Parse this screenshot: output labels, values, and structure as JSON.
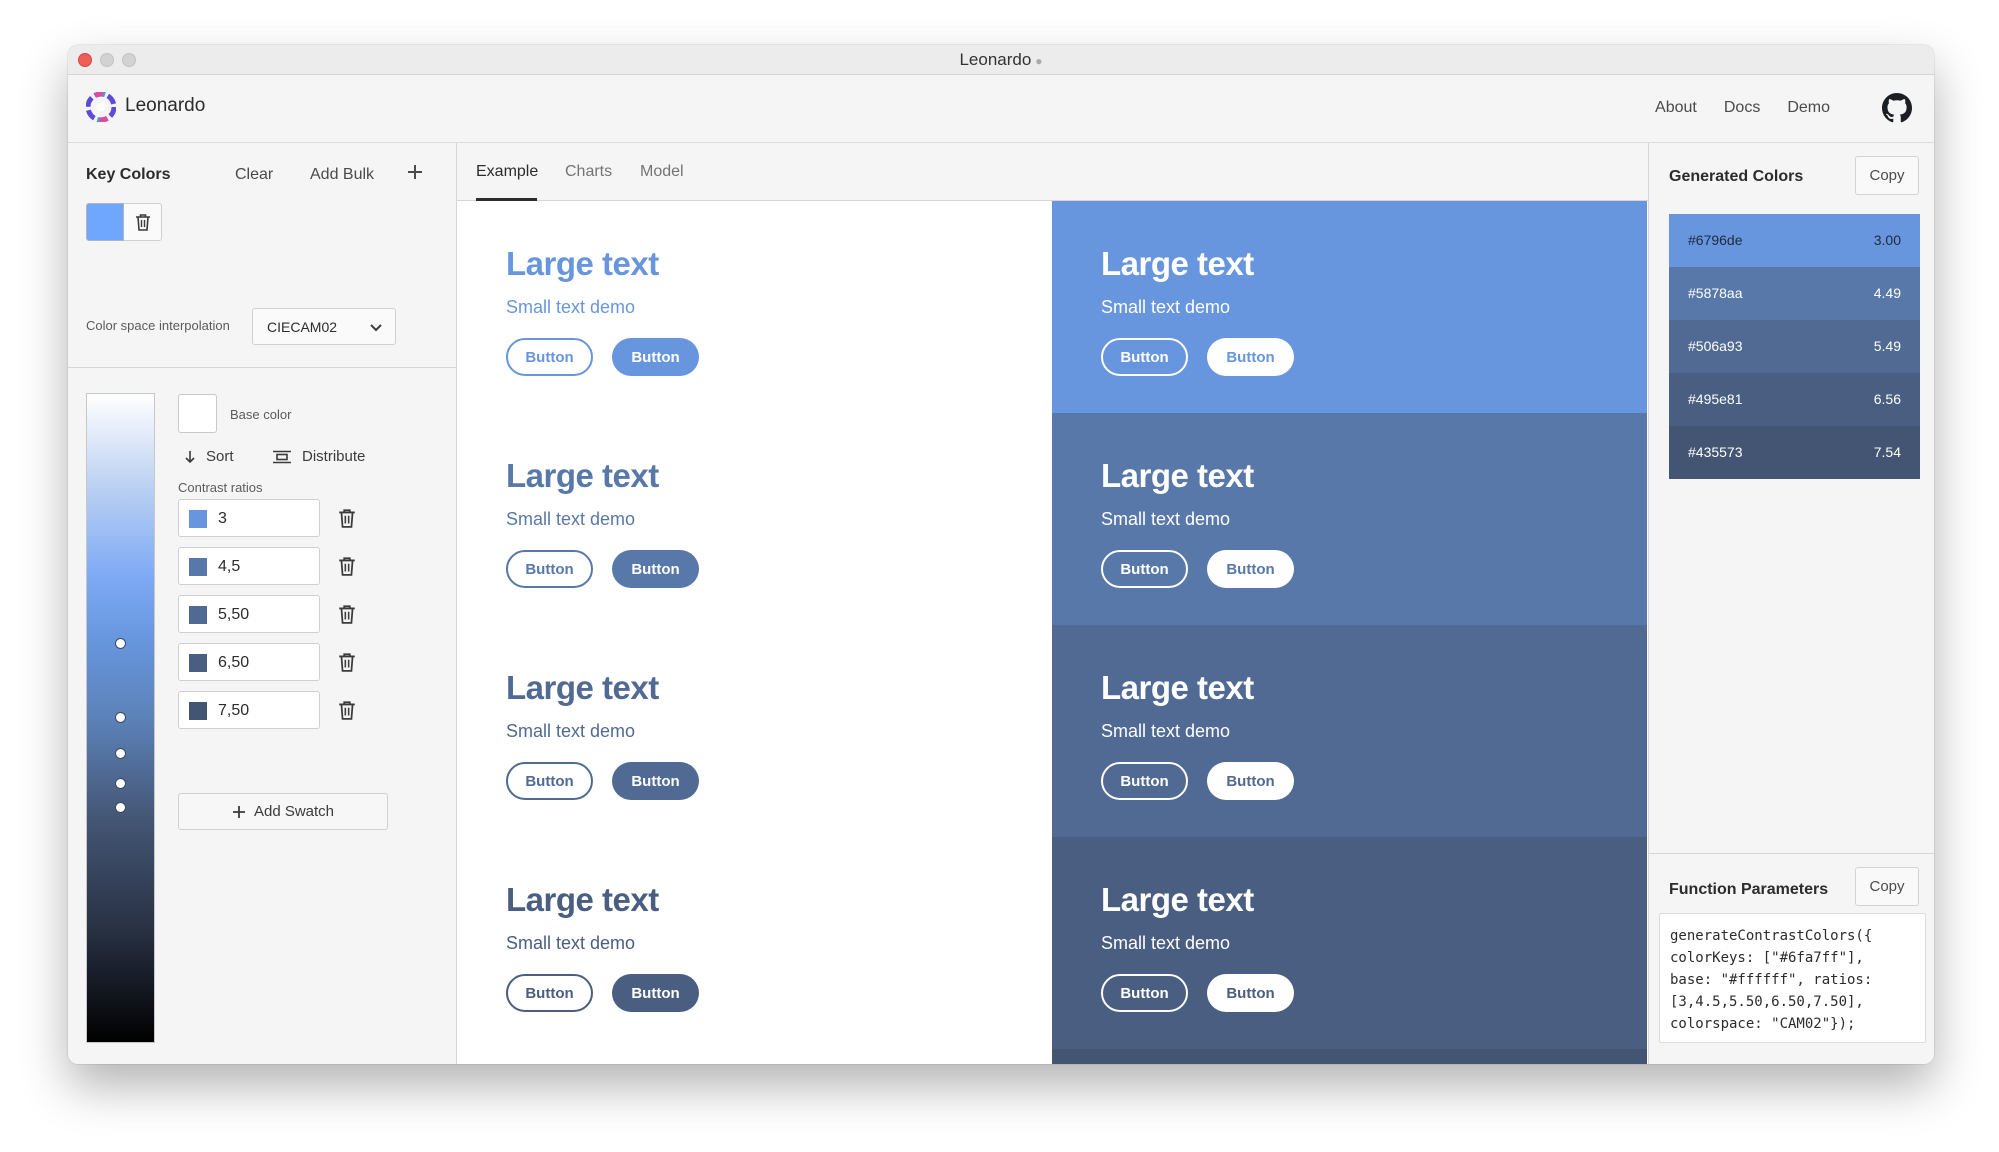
{
  "window": {
    "title": "Leonardo"
  },
  "header": {
    "brand": "Leonardo",
    "nav": [
      "About",
      "Docs",
      "Demo"
    ]
  },
  "key_colors": {
    "title": "Key Colors",
    "clear_label": "Clear",
    "add_bulk_label": "Add Bulk",
    "swatch_color": "#6fa7ff"
  },
  "color_space": {
    "label": "Color space interpolation",
    "value": "CIECAM02"
  },
  "base_color": {
    "label": "Base color",
    "color": "#ffffff"
  },
  "actions": {
    "sort_label": "Sort",
    "distribute_label": "Distribute"
  },
  "contrast": {
    "label": "Contrast ratios",
    "ratios": [
      {
        "value": "3",
        "color": "#6796de"
      },
      {
        "value": "4,5",
        "color": "#5878aa"
      },
      {
        "value": "5,50",
        "color": "#506a93"
      },
      {
        "value": "6,50",
        "color": "#495e81"
      },
      {
        "value": "7,50",
        "color": "#435573"
      }
    ],
    "add_swatch_label": "Add Swatch"
  },
  "tabs": [
    "Example",
    "Charts",
    "Model"
  ],
  "demo": {
    "large_text": "Large text",
    "small_text": "Small text demo",
    "button_label": "Button"
  },
  "generated": {
    "title": "Generated Colors",
    "copy_label": "Copy",
    "colors": [
      {
        "hex": "#6796de",
        "ratio": "3.00"
      },
      {
        "hex": "#5878aa",
        "ratio": "4.49"
      },
      {
        "hex": "#506a93",
        "ratio": "5.49"
      },
      {
        "hex": "#495e81",
        "ratio": "6.56"
      },
      {
        "hex": "#435573",
        "ratio": "7.54"
      }
    ]
  },
  "function_params": {
    "title": "Function Parameters",
    "copy_label": "Copy",
    "code": "generateContrastColors({\ncolorKeys: [\"#6fa7ff\"],\nbase: \"#ffffff\", ratios:\n[3,4.5,5.50,6.50,7.50],\ncolorspace: \"CAM02\"});"
  }
}
